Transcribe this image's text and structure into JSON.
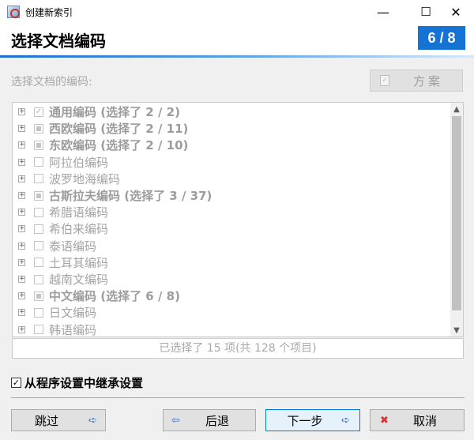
{
  "window": {
    "title": "创建新索引",
    "minimize_glyph": "—",
    "maximize_glyph": "☐",
    "close_glyph": "✕"
  },
  "header": {
    "title": "选择文档编码",
    "step": "6 / 8"
  },
  "prompt": "选择文档的编码:",
  "scheme_button": {
    "label": "方案",
    "icon": "document-icon"
  },
  "tree_items": [
    {
      "label": "通用编码 (选择了 2 / 2)",
      "state": "checked",
      "bold": true
    },
    {
      "label": "西欧编码 (选择了 2 / 11)",
      "state": "partial",
      "bold": true
    },
    {
      "label": "东欧编码 (选择了 2 / 10)",
      "state": "partial",
      "bold": true
    },
    {
      "label": "阿拉伯编码",
      "state": "unchecked",
      "bold": false
    },
    {
      "label": "波罗地海编码",
      "state": "unchecked",
      "bold": false
    },
    {
      "label": "古斯拉夫编码 (选择了 3 / 37)",
      "state": "partial",
      "bold": true
    },
    {
      "label": "希腊语编码",
      "state": "unchecked",
      "bold": false
    },
    {
      "label": "希伯来编码",
      "state": "unchecked",
      "bold": false
    },
    {
      "label": "泰语编码",
      "state": "unchecked",
      "bold": false
    },
    {
      "label": "土耳其编码",
      "state": "unchecked",
      "bold": false
    },
    {
      "label": "越南文编码",
      "state": "unchecked",
      "bold": false
    },
    {
      "label": "中文编码 (选择了 6 / 8)",
      "state": "partial",
      "bold": true
    },
    {
      "label": "日文编码",
      "state": "unchecked",
      "bold": false
    },
    {
      "label": "韩语编码",
      "state": "unchecked",
      "bold": false
    }
  ],
  "summary": "已选择了 15 项(共 128 个项目)",
  "inherit": {
    "label": "从程序设置中继承设置",
    "checked": true
  },
  "buttons": {
    "skip": "跳过",
    "back": "后退",
    "next": "下一步",
    "cancel": "取消"
  },
  "colors": {
    "accent": "#1673d6",
    "button_arrow": "#2b6fd4",
    "cancel_icon": "#d9342b"
  }
}
